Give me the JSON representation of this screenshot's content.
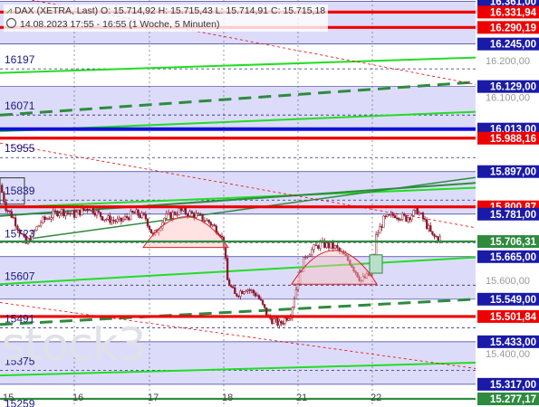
{
  "header": {
    "instrument_line": "DAX (XETRA, Last)  O: 15.714,92  H: 15.715,43  L: 15.714,91  C: 15.715,18",
    "period_line": "14.08.2023 17:55 - 16:55   (1 Woche, 5 Minuten)",
    "instrument_icon": "line-chart-icon",
    "period_icon": "clock-icon"
  },
  "watermark": "stock3",
  "colors": {
    "band": "#dcdcfa",
    "support_green": "#22dd22",
    "trend_dark_green": "#2e8b3e",
    "resistance_red": "#ee0000",
    "blue_level": "#1010dd",
    "candle": "#8b1a2e",
    "label_blue_bg": "#1a1aa8"
  },
  "chart_data": {
    "type": "candlestick",
    "title": "",
    "xlabel": "",
    "ylabel": "",
    "ylim": [
      15255,
      16365
    ],
    "x_ticks": [
      "15",
      "16",
      "17",
      "18",
      "21",
      "22"
    ],
    "grid_labels_left": [
      "16197",
      "16071",
      "15955",
      "15839",
      "15723",
      "15607",
      "15491",
      "15375",
      "15259"
    ],
    "axis_labels_right": [
      "16.200,00",
      "16.100,00",
      "15.600,00",
      "15.400,00"
    ],
    "price_levels": [
      {
        "value": 16361.0,
        "label": "16.361,00",
        "color": "#1a1aa8"
      },
      {
        "value": 16331.94,
        "label": "16.331,94",
        "color": "#ee0000"
      },
      {
        "value": 16290.19,
        "label": "16.290,19",
        "color": "#ee0000"
      },
      {
        "value": 16245.0,
        "label": "16.245,00",
        "color": "#1a1aa8"
      },
      {
        "value": 16129.0,
        "label": "16.129,00",
        "color": "#1a1aa8"
      },
      {
        "value": 16013.0,
        "label": "16.013,00",
        "color": "#1a1aa8"
      },
      {
        "value": 15988.16,
        "label": "15.988,16",
        "color": "#ee0000"
      },
      {
        "value": 15897.0,
        "label": "15.897,00",
        "color": "#1a1aa8"
      },
      {
        "value": 15800.87,
        "label": "15.800,87",
        "color": "#ee0000"
      },
      {
        "value": 15781.0,
        "label": "15.781,00",
        "color": "#1a1aa8"
      },
      {
        "value": 15706.31,
        "label": "15.706,31",
        "color": "#2e8b3e"
      },
      {
        "value": 15665.0,
        "label": "15.665,00",
        "color": "#1a1aa8"
      },
      {
        "value": 15549.0,
        "label": "15.549,00",
        "color": "#1a1aa8"
      },
      {
        "value": 15501.84,
        "label": "15.501,84",
        "color": "#ee0000"
      },
      {
        "value": 15433.0,
        "label": "15.433,00",
        "color": "#1a1aa8"
      },
      {
        "value": 15317.0,
        "label": "15.317,00",
        "color": "#1a1aa8"
      },
      {
        "value": 15277.17,
        "label": "15.277,17",
        "color": "#2e8b3e"
      }
    ],
    "price_path": [
      [
        0,
        15860
      ],
      [
        0.08,
        15800
      ],
      [
        0.18,
        15770
      ],
      [
        0.35,
        15700
      ],
      [
        0.55,
        15760
      ],
      [
        0.8,
        15790
      ],
      [
        1.0,
        15780
      ],
      [
        1.2,
        15800
      ],
      [
        1.4,
        15770
      ],
      [
        1.6,
        15760
      ],
      [
        1.8,
        15785
      ],
      [
        1.95,
        15770
      ],
      [
        2.05,
        15720
      ],
      [
        2.2,
        15770
      ],
      [
        2.4,
        15790
      ],
      [
        2.6,
        15780
      ],
      [
        2.8,
        15760
      ],
      [
        2.95,
        15730
      ],
      [
        3.0,
        15700
      ],
      [
        3.05,
        15600
      ],
      [
        3.15,
        15560
      ],
      [
        3.3,
        15580
      ],
      [
        3.45,
        15560
      ],
      [
        3.6,
        15500
      ],
      [
        3.75,
        15480
      ],
      [
        3.9,
        15510
      ],
      [
        4.0,
        15600
      ],
      [
        4.1,
        15670
      ],
      [
        4.3,
        15700
      ],
      [
        4.5,
        15690
      ],
      [
        4.7,
        15650
      ],
      [
        4.85,
        15600
      ],
      [
        5.0,
        15620
      ],
      [
        5.05,
        15720
      ],
      [
        5.15,
        15765
      ],
      [
        5.3,
        15780
      ],
      [
        5.45,
        15770
      ],
      [
        5.6,
        15790
      ],
      [
        5.7,
        15760
      ],
      [
        5.8,
        15720
      ],
      [
        5.9,
        15715
      ]
    ]
  }
}
